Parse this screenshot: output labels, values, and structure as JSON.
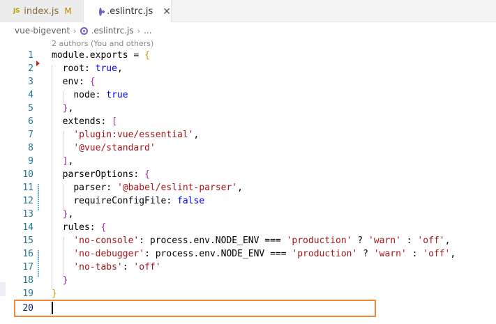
{
  "tabs": [
    {
      "icon": "JS",
      "label": "index.js",
      "status": "M"
    },
    {
      "label": ".eslintrc.js",
      "close": "✕"
    }
  ],
  "breadcrumb": {
    "folder": "vue-bigevent",
    "file": ".eslintrc.js",
    "more": "..."
  },
  "blame": "2 authors (You and others)",
  "lines": [
    {
      "num": "1"
    },
    {
      "num": "2"
    },
    {
      "num": "3"
    },
    {
      "num": "4"
    },
    {
      "num": "5"
    },
    {
      "num": "6"
    },
    {
      "num": "7"
    },
    {
      "num": "8"
    },
    {
      "num": "9"
    },
    {
      "num": "10"
    },
    {
      "num": "11"
    },
    {
      "num": "12"
    },
    {
      "num": "13"
    },
    {
      "num": "14"
    },
    {
      "num": "15"
    },
    {
      "num": "16"
    },
    {
      "num": "17"
    },
    {
      "num": "18"
    },
    {
      "num": "19"
    },
    {
      "num": "20"
    }
  ],
  "code": {
    "l1": {
      "a": "module.exports = ",
      "b": "{"
    },
    "l2": {
      "a": "root: ",
      "b": "true",
      "c": ","
    },
    "l3": {
      "a": "env: ",
      "b": "{"
    },
    "l4": {
      "a": "node: ",
      "b": "true"
    },
    "l5": {
      "a": "}",
      "b": ","
    },
    "l6": {
      "a": "extends: ",
      "b": "["
    },
    "l7": {
      "a": "'plugin:vue/essential'",
      "b": ","
    },
    "l8": {
      "a": "'@vue/standard'"
    },
    "l9": {
      "a": "]",
      "b": ","
    },
    "l10": {
      "a": "parserOptions: ",
      "b": "{"
    },
    "l11": {
      "a": "parser: ",
      "b": "'@babel/eslint-parser'",
      "c": ","
    },
    "l12": {
      "a": "requireConfigFile: ",
      "b": "false"
    },
    "l13": {
      "a": "}",
      "b": ","
    },
    "l14": {
      "a": "rules: ",
      "b": "{"
    },
    "l15": {
      "a": "'no-console'",
      "b": ": process.env.NODE_ENV === ",
      "c": "'production'",
      "d": " ? ",
      "e": "'warn'",
      "f": " : ",
      "g": "'off'",
      "h": ","
    },
    "l16": {
      "a": "'no-debugger'",
      "b": ": process.env.NODE_ENV === ",
      "c": "'production'",
      "d": " ? ",
      "e": "'warn'",
      "f": " : ",
      "g": "'off'",
      "h": ","
    },
    "l17": {
      "a": "'no-tabs'",
      "b": ": ",
      "c": "'off'"
    },
    "l18": {
      "a": "}"
    },
    "l19": {
      "a": "}"
    }
  },
  "colors": {
    "keyword": "#0000ff",
    "string": "#a31515",
    "bracket_level1": "#c9a100",
    "bracket_level2": "#a42ea2",
    "line_number": "#237893",
    "highlight_box": "#f08a38"
  }
}
